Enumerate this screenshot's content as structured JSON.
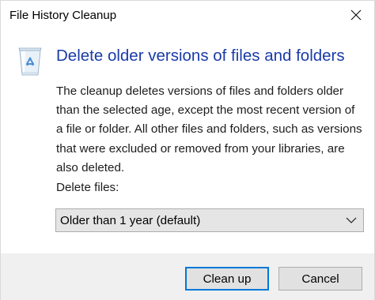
{
  "window": {
    "title": "File History Cleanup"
  },
  "dialog": {
    "heading": "Delete older versions of files and folders",
    "description": "The cleanup deletes versions of files and folders older than the selected age, except the most recent version of a file or folder. All other files and folders, such as versions that were excluded or removed from your libraries, are also deleted.",
    "delete_files_label": "Delete files:",
    "dropdown": {
      "selected": "Older than 1 year (default)"
    },
    "icon": "recycle-bin-icon"
  },
  "buttons": {
    "cleanup": "Clean up",
    "cancel": "Cancel"
  },
  "colors": {
    "heading": "#1a3ba8",
    "primary_border": "#0078d7",
    "footer_bg": "#f0f0f0"
  }
}
